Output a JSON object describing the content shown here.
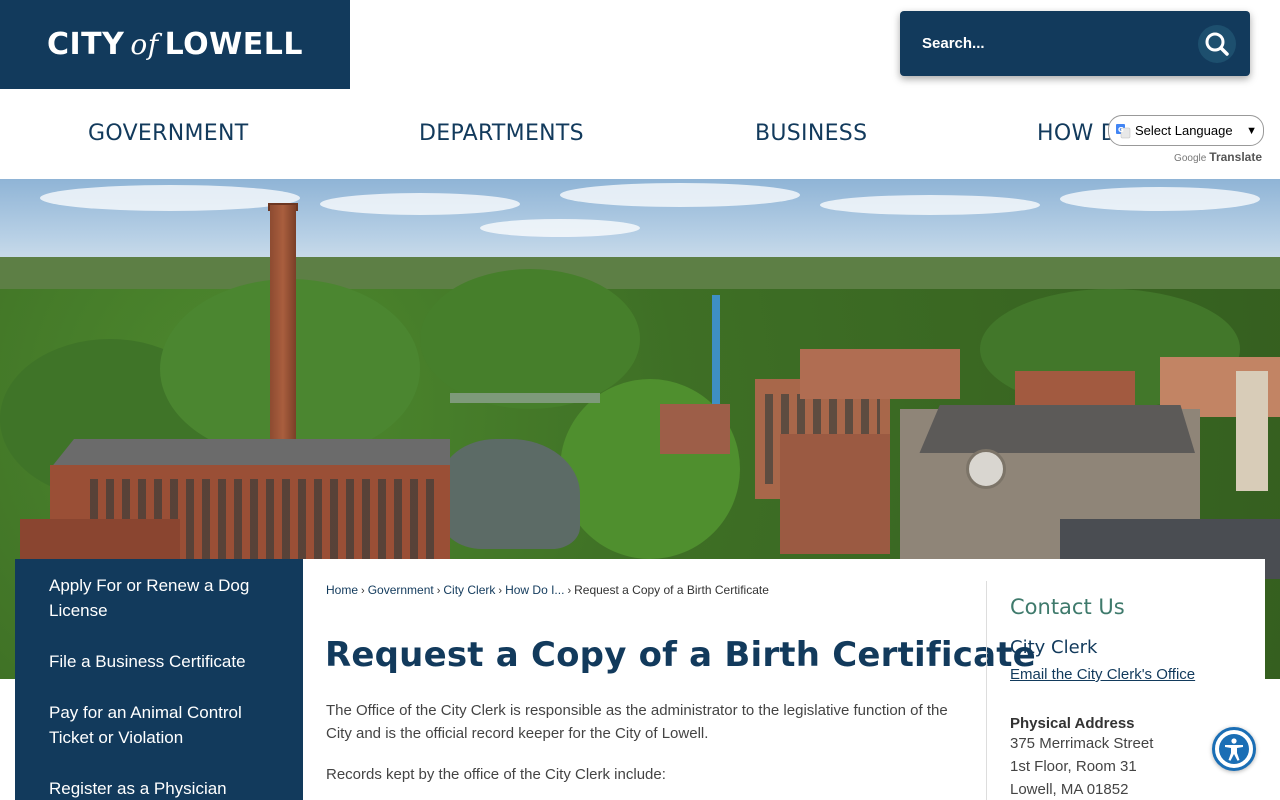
{
  "header": {
    "logo": {
      "city": "CITY",
      "of": "of",
      "name": "LOWELL"
    },
    "search": {
      "placeholder": "Search...",
      "icon": "search-icon"
    }
  },
  "nav": {
    "items": [
      {
        "label": "GOVERNMENT"
      },
      {
        "label": "DEPARTMENTS"
      },
      {
        "label": "BUSINESS"
      },
      {
        "label": "HOW DO I..."
      }
    ]
  },
  "translate": {
    "select_label": "Select Language",
    "powered_by": "Google",
    "translate_label": "Translate"
  },
  "sidebar": {
    "items": [
      {
        "label": "Apply For or Renew a Dog License"
      },
      {
        "label": "File a Business Certificate"
      },
      {
        "label": "Pay for an Animal Control Ticket or Violation"
      },
      {
        "label": "Register as a Physician"
      }
    ]
  },
  "breadcrumb": {
    "items": [
      {
        "label": "Home"
      },
      {
        "label": "Government"
      },
      {
        "label": "City Clerk"
      },
      {
        "label": "How Do I..."
      }
    ],
    "current": "Request a Copy of a Birth Certificate"
  },
  "main": {
    "title": "Request a Copy of a Birth Certificate",
    "intro": "The Office of the City Clerk is responsible as the administrator to the legislative function of the City and is the official record keeper for the City of Lowell.",
    "records_lead": "Records kept by the office of the City Clerk include:"
  },
  "contact": {
    "heading": "Contact Us",
    "org": "City Clerk",
    "email_link": "Email the City Clerk's Office",
    "address_label": "Physical Address",
    "address_lines": [
      "375 Merrimack Street",
      "1st Floor, Room 31",
      "Lowell, MA 01852"
    ]
  },
  "colors": {
    "brand_navy": "#123a5c",
    "contact_heading": "#3f7a6c",
    "accessibility_blue": "#1a6eb5"
  },
  "accessibility": {
    "icon": "accessibility-icon"
  }
}
